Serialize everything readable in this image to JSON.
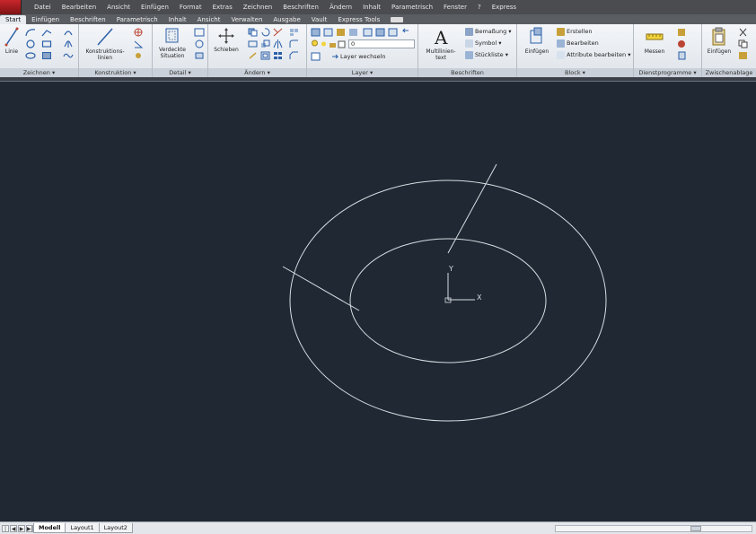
{
  "menubar": {
    "items": [
      "Datei",
      "Bearbeiten",
      "Ansicht",
      "Einfügen",
      "Format",
      "Extras",
      "Zeichnen",
      "Beschriften",
      "Ändern",
      "Inhalt",
      "Parametrisch",
      "Fenster",
      "?",
      "Express"
    ]
  },
  "ribbon_tabs": [
    "Start",
    "Einfügen",
    "Beschriften",
    "Parametrisch",
    "Inhalt",
    "Ansicht",
    "Verwalten",
    "Ausgabe",
    "Vault",
    "Express Tools"
  ],
  "ribbon": {
    "zeichnen": {
      "title": "Zeichnen ▾",
      "line_label": "Linie"
    },
    "konstruktion": {
      "title": "Konstruktion ▾",
      "btn_label_1": "Konstruktions-",
      "btn_label_2": "linien"
    },
    "detail": {
      "title": "Detail ▾",
      "btn_label_1": "Verdeckte",
      "btn_label_2": "Situation"
    },
    "aendern": {
      "title": "Ändern ▾",
      "btn_label": "Schieben"
    },
    "layer": {
      "title": "Layer ▾",
      "current_layer": "0",
      "switch_label": "Layer wechseln"
    },
    "beschriften": {
      "title": "Beschriften",
      "mtext_1": "Multilinien-",
      "mtext_2": "text",
      "bemassung": "Bemaßung",
      "symbol": "Symbol",
      "stueckliste": "Stückliste"
    },
    "block": {
      "title": "Block ▾",
      "insert_label": "Einfügen",
      "erstellen": "Erstellen",
      "bearbeiten": "Bearbeiten",
      "attribute": "Attribute bearbeiten"
    },
    "dienstprogramme": {
      "title": "Dienstprogramme ▾",
      "messen": "Messen"
    },
    "zwischenablage": {
      "title": "Zwischenablage",
      "insert_label": "Einfügen"
    }
  },
  "canvas": {
    "ucs_x_label": "X",
    "ucs_y_label": "Y",
    "colors": {
      "background": "#1f2833",
      "geometry": "#d8dde3"
    }
  },
  "layout_tabs": [
    "Modell",
    "Layout1",
    "Layout2"
  ],
  "nav_buttons": [
    "|◀",
    "◀",
    "▶",
    "▶|"
  ]
}
